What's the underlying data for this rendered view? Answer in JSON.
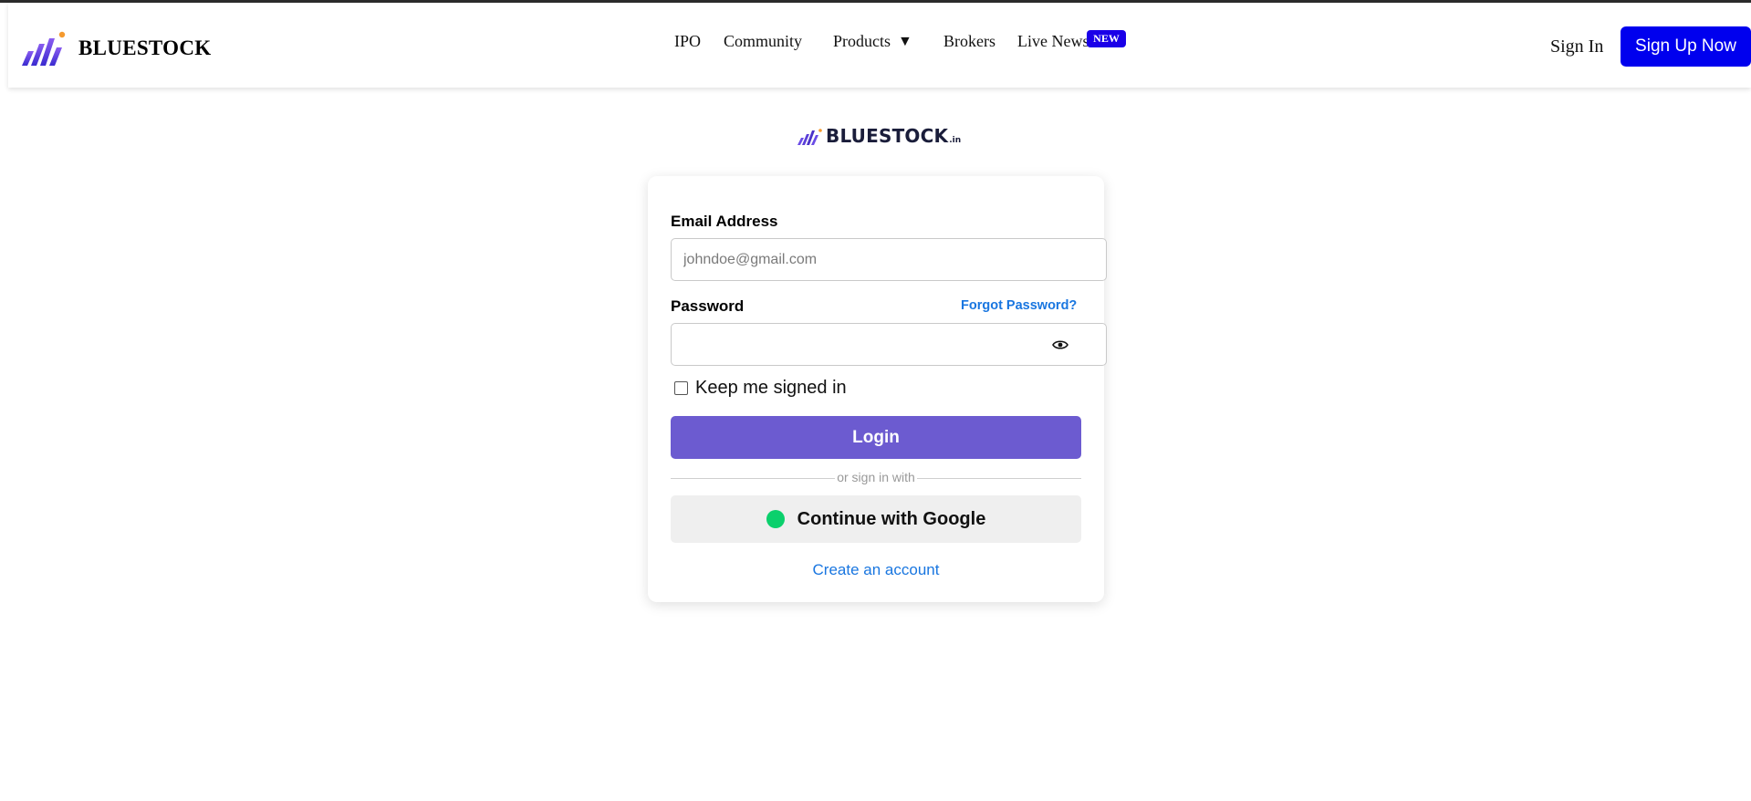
{
  "header": {
    "brand_name": "BLUESTOCK",
    "nav": [
      {
        "label": "IPO"
      },
      {
        "label": "Community"
      },
      {
        "label": "Products"
      },
      {
        "label": "Brokers"
      },
      {
        "label": "Live News"
      }
    ],
    "products_caret": "▼",
    "new_badge": "NEW",
    "sign_in": "Sign In",
    "sign_up": "Sign Up Now"
  },
  "center_logo": {
    "name": "BLUESTOCK",
    "suffix": ".in"
  },
  "login_form": {
    "email_label": "Email Address",
    "email_placeholder": "johndoe@gmail.com",
    "email_value": "",
    "password_label": "Password",
    "password_value": "",
    "forgot_password": "Forgot Password?",
    "keep_signed_in": "Keep me signed in",
    "keep_signed_in_checked": false,
    "login_button": "Login",
    "divider_text": "or sign in with",
    "google_button": "Continue with Google",
    "create_account": "Create an account"
  },
  "icons": {
    "brand_logo": "bluestock-bars-logo",
    "password_toggle": "eye-icon",
    "google_marker": "green-dot-icon"
  },
  "colors": {
    "primary_blue": "#0000ee",
    "badge_blue": "#1a00e8",
    "login_purple": "#6c5bd0",
    "link_blue": "#1976e0",
    "google_dot": "#0bd06c",
    "logo_purple": "#5b3fd8",
    "logo_orange": "#f59a2f"
  }
}
